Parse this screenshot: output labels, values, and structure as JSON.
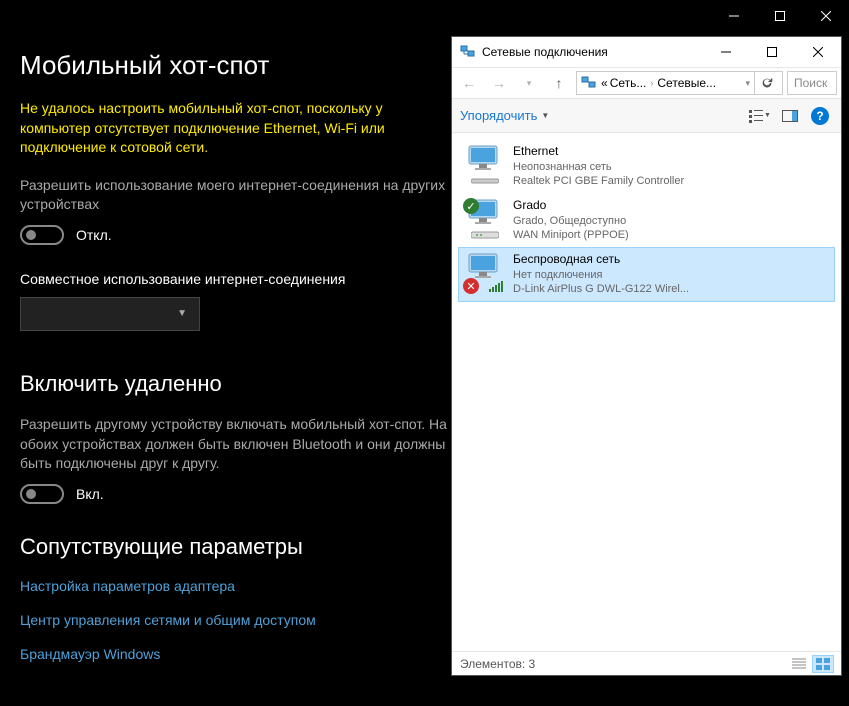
{
  "settings": {
    "title": "Мобильный хот-спот",
    "warning": "Не удалось настроить мобильный хот-спот, поскольку у компьютер отсутствует подключение Ethernet, Wi-Fi или подключение к сотовой сети.",
    "share_desc": "Разрешить использование моего интернет-соединения на других устройствах",
    "toggle_off_label": "Откл.",
    "share_heading": "Совместное использование интернет-соединения",
    "remote_title": "Включить удаленно",
    "remote_desc": "Разрешить другому устройству включать мобильный хот-спот. На обоих устройствах должен быть включен Bluetooth и они должны быть подключены друг к другу.",
    "toggle_on_label": "Вкл.",
    "related_title": "Сопутствующие параметры",
    "links": {
      "adapter": "Настройка параметров адаптера",
      "sharing": "Центр управления сетями и общим доступом",
      "firewall": "Брандмауэр Windows"
    }
  },
  "window": {
    "title": "Сетевые подключения",
    "breadcrumb": {
      "p1": "Сеть...",
      "p2": "Сетевые..."
    },
    "search_placeholder": "Поиск",
    "organize": "Упорядочить",
    "connections": [
      {
        "name": "Ethernet",
        "status": "Неопознанная сеть",
        "device": "Realtek PCI GBE Family Controller",
        "selected": false,
        "icon": "ethernet"
      },
      {
        "name": "Grado",
        "status": "Grado, Общедоступно",
        "device": "WAN Miniport (PPPOE)",
        "selected": false,
        "icon": "modem"
      },
      {
        "name": "Беспроводная сеть",
        "status": "Нет подключения",
        "device": "D-Link AirPlus G DWL-G122 Wirel...",
        "selected": true,
        "icon": "wifi"
      }
    ],
    "status_prefix": "Элементов:",
    "status_count": "3"
  }
}
